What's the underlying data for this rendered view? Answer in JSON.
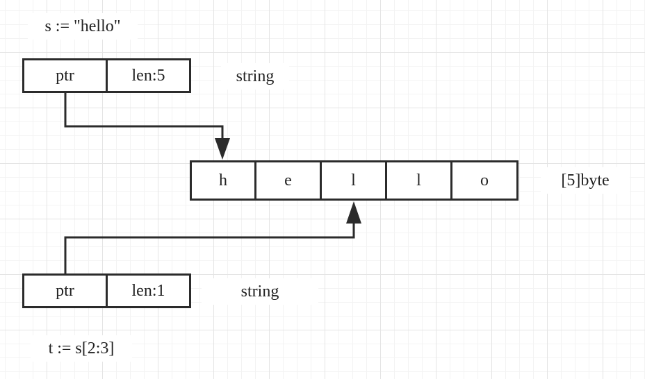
{
  "code": {
    "s_decl": "s := \"hello\"",
    "t_decl": "t := s[2:3]"
  },
  "string_s": {
    "ptr_label": "ptr",
    "len_label": "len:5",
    "type_label": "string"
  },
  "byte_array": {
    "cells": [
      "h",
      "e",
      "l",
      "l",
      "o"
    ],
    "type_label": "[5]byte"
  },
  "string_t": {
    "ptr_label": "ptr",
    "len_label": "len:1",
    "type_label": "string"
  },
  "colors": {
    "stroke": "#2b2b2b",
    "grid_major": "#e4e4e4",
    "grid_minor": "#f3f3f3"
  }
}
